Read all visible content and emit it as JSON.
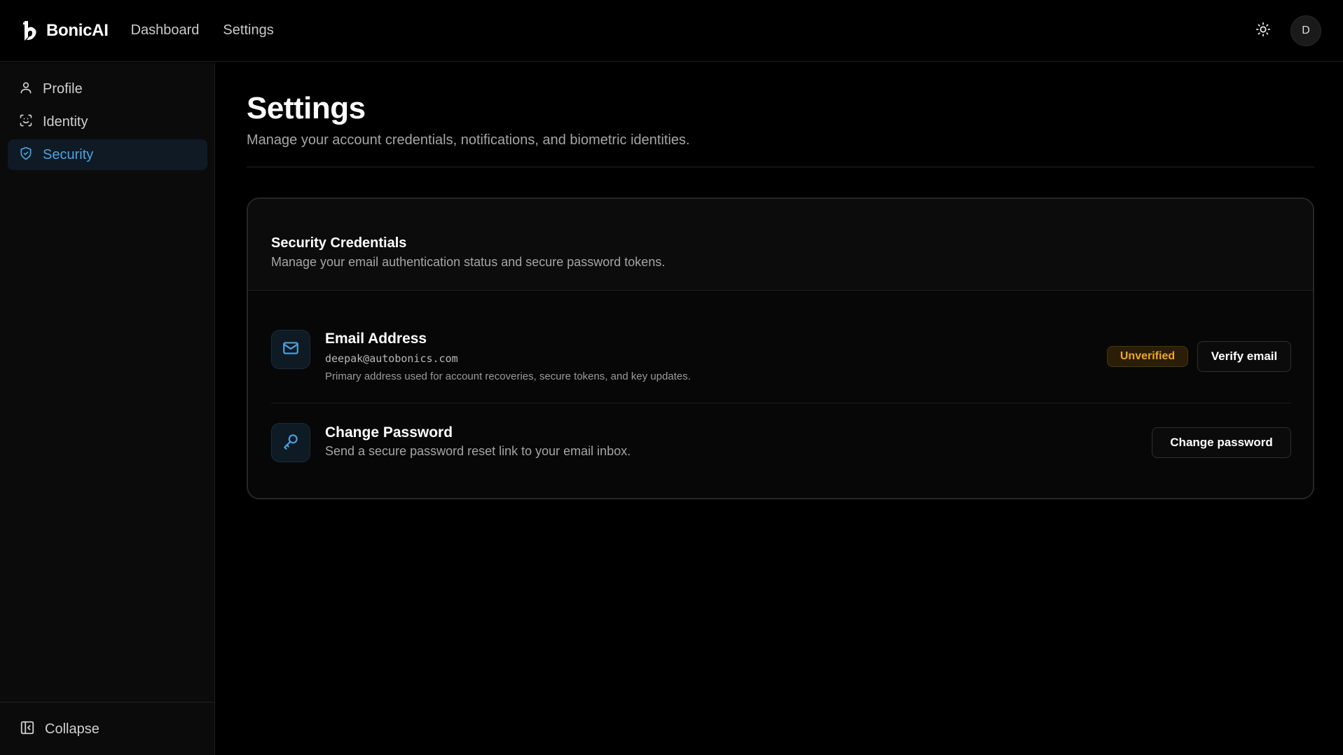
{
  "brand": {
    "name": "BonicAI"
  },
  "topnav": {
    "items": [
      {
        "label": "Dashboard"
      },
      {
        "label": "Settings"
      }
    ]
  },
  "user": {
    "avatar_initial": "D"
  },
  "sidebar": {
    "items": [
      {
        "label": "Profile",
        "icon": "user-icon",
        "active": false
      },
      {
        "label": "Identity",
        "icon": "face-scan-icon",
        "active": false
      },
      {
        "label": "Security",
        "icon": "shield-check-icon",
        "active": true
      }
    ],
    "collapse_label": "Collapse"
  },
  "page": {
    "title": "Settings",
    "subtitle": "Manage your account credentials, notifications, and biometric identities."
  },
  "card": {
    "title": "Security Credentials",
    "description": "Manage your email authentication status and secure password tokens.",
    "email": {
      "title": "Email Address",
      "value": "deepak@autobonics.com",
      "note": "Primary address used for account recoveries, secure tokens, and key updates.",
      "status_badge": "Unverified",
      "action_label": "Verify email"
    },
    "password": {
      "title": "Change Password",
      "description": "Send a secure password reset link to your email inbox.",
      "action_label": "Change password"
    }
  },
  "colors": {
    "accent": "#4aa3e0",
    "warning": "#f0a623",
    "background": "#000000"
  }
}
